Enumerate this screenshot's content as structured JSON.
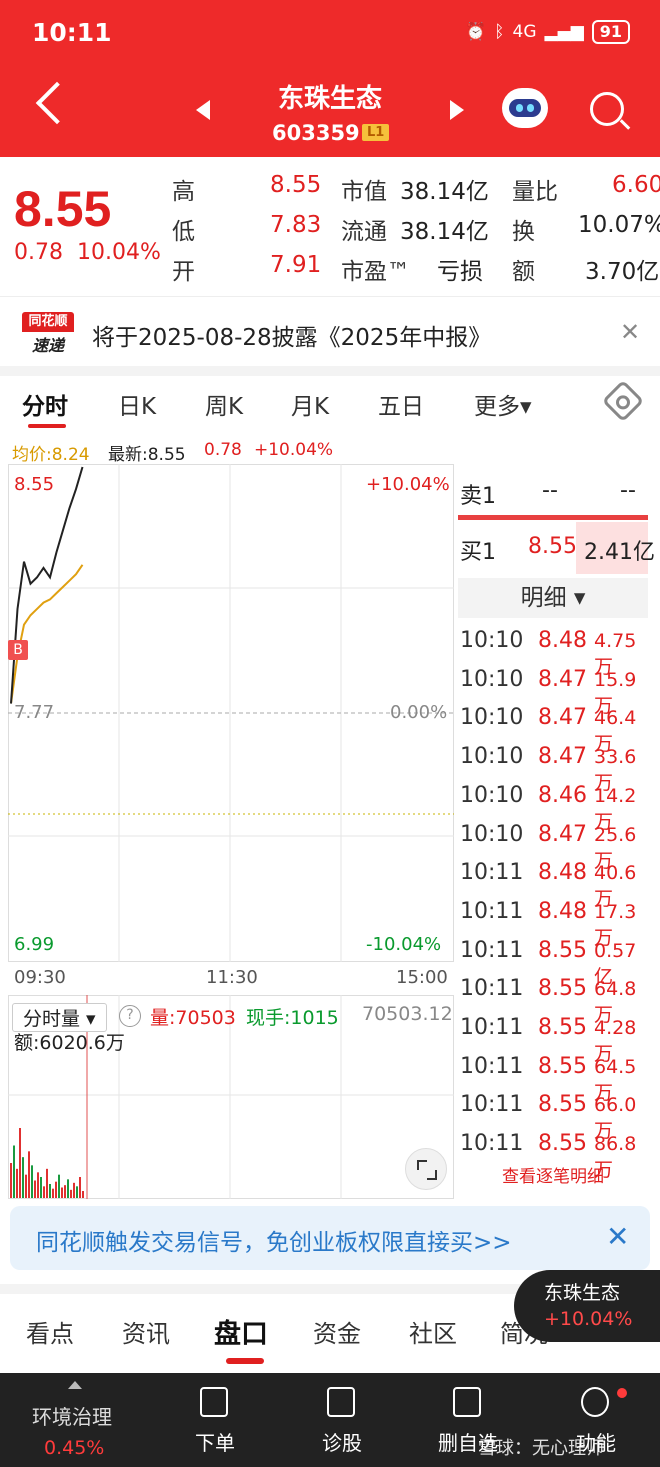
{
  "status_bar": {
    "time": "10:11",
    "network": "4G",
    "battery": "91"
  },
  "header": {
    "stock_name": "东珠生态",
    "stock_code": "603359",
    "level_badge": "L1"
  },
  "quote": {
    "price": "8.55",
    "change": "0.78",
    "change_pct": "10.04%",
    "rows": [
      {
        "l1": "高",
        "v1": "8.55",
        "l2": "市值",
        "v2": "38.14亿",
        "l3": "量比",
        "v3": "6.60"
      },
      {
        "l1": "低",
        "v1": "7.83",
        "l2": "流通",
        "v2": "38.14亿",
        "l3": "换",
        "v3": "10.07%"
      },
      {
        "l1": "开",
        "v1": "7.91",
        "l2": "市盈™",
        "v2": "亏损",
        "l3": "额",
        "v3": "3.70亿"
      }
    ]
  },
  "notice": {
    "logo_top": "同花顺",
    "logo_bottom": "速递",
    "text": "将于2025-08-28披露《2025年中报》"
  },
  "chart_tabs": [
    "分时",
    "日K",
    "周K",
    "月K",
    "五日",
    "更多▾"
  ],
  "chart_info": {
    "avg_label": "均价:8.24",
    "latest_label": "最新:8.55",
    "chg": "0.78",
    "pct": "+10.04%"
  },
  "chart_axis": {
    "high": "8.55",
    "high_pct": "+10.04%",
    "mid": "7.77",
    "mid_pct": "0.00%",
    "low": "6.99",
    "low_pct": "-10.04%",
    "times": [
      "09:30",
      "11:30",
      "15:00"
    ],
    "buy_marker": "B"
  },
  "chart_data": {
    "type": "line",
    "title": "",
    "x": [
      "09:30",
      "09:31",
      "09:32",
      "09:33",
      "09:34",
      "09:35",
      "09:36",
      "09:37",
      "09:38",
      "09:39",
      "09:40",
      "09:41"
    ],
    "series": [
      {
        "name": "",
        "values": [
          7.8,
          8.1,
          8.25,
          8.18,
          8.2,
          8.23,
          8.2,
          8.28,
          8.35,
          8.42,
          8.48,
          8.55
        ]
      },
      {
        "name": "均价",
        "values": [
          7.8,
          7.95,
          8.05,
          8.08,
          8.1,
          8.12,
          8.13,
          8.15,
          8.17,
          8.19,
          8.21,
          8.24
        ]
      }
    ],
    "ylim": [
      6.99,
      8.55
    ],
    "xlim": [
      "09:30",
      "15:00"
    ],
    "volume_label": "分时量",
    "volume_values": [
      30,
      45,
      25,
      60,
      35,
      20,
      40,
      28,
      15,
      22,
      18,
      10,
      25,
      12,
      8,
      14,
      20,
      9,
      11,
      16,
      7,
      13,
      10,
      18,
      6
    ]
  },
  "volume": {
    "title": "分时量",
    "amount": "额:6020.6万",
    "vol": "量:70503",
    "hand": "现手:1015",
    "total": "70503.12"
  },
  "order_book": {
    "sell_label": "卖1",
    "sell_price": "--",
    "sell_vol": "--",
    "buy_label": "买1",
    "buy_price": "8.55",
    "buy_vol": "2.41亿",
    "detail_label": "明细 ▾",
    "ticks": [
      {
        "t": "10:10",
        "p": "8.48",
        "v": "4.75万"
      },
      {
        "t": "10:10",
        "p": "8.47",
        "v": "15.9万"
      },
      {
        "t": "10:10",
        "p": "8.47",
        "v": "46.4万"
      },
      {
        "t": "10:10",
        "p": "8.47",
        "v": "33.6万"
      },
      {
        "t": "10:10",
        "p": "8.46",
        "v": "14.2万"
      },
      {
        "t": "10:10",
        "p": "8.47",
        "v": "25.6万"
      },
      {
        "t": "10:11",
        "p": "8.48",
        "v": "40.6万"
      },
      {
        "t": "10:11",
        "p": "8.48",
        "v": "17.3万"
      },
      {
        "t": "10:11",
        "p": "8.55",
        "v": "0.57亿"
      },
      {
        "t": "10:11",
        "p": "8.55",
        "v": "64.8万"
      },
      {
        "t": "10:11",
        "p": "8.55",
        "v": "4.28万"
      },
      {
        "t": "10:11",
        "p": "8.55",
        "v": "64.5万"
      },
      {
        "t": "10:11",
        "p": "8.55",
        "v": "66.0万"
      },
      {
        "t": "10:11",
        "p": "8.55",
        "v": "86.8万"
      }
    ],
    "view_more": "查看逐笔明细"
  },
  "promo": {
    "text": "同花顺触发交易信号，免创业板权限直接买>>",
    "close": "✕"
  },
  "bottom_tabs": [
    "看点",
    "资讯",
    "盘口",
    "资金",
    "社区",
    "简况"
  ],
  "float_card": {
    "name": "东珠生态",
    "pct": "+10.04%"
  },
  "bottom_bar": {
    "sector": "环境治理",
    "sector_pct": "0.45%",
    "items": [
      "下单",
      "诊股",
      "删自选",
      "功能"
    ],
    "watermark": "雪球：无心理师"
  },
  "colors": {
    "up": "#e02020",
    "down": "#0a9a2e",
    "header": "#ee2a2a",
    "avg_line": "#e0a010"
  }
}
